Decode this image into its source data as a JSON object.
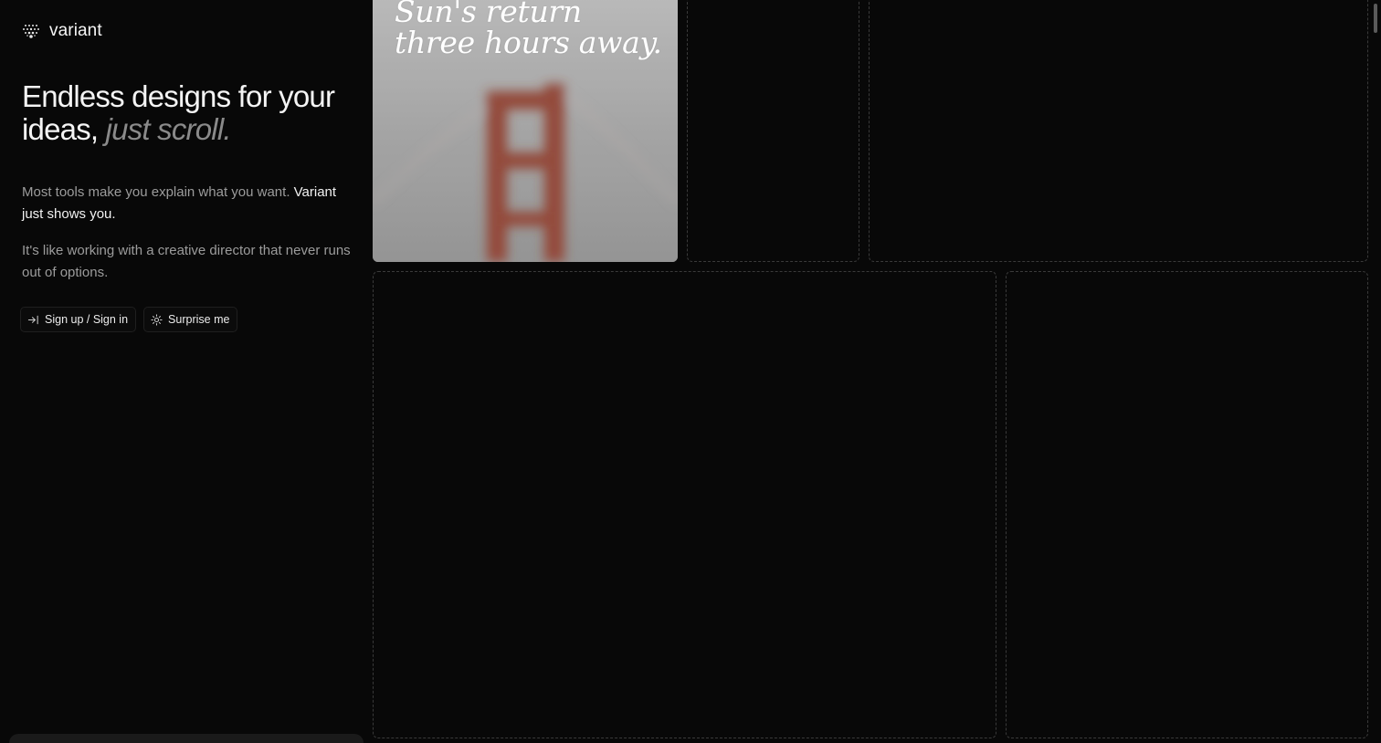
{
  "brand": {
    "name": "variant",
    "logo_icon": "dot-grid-logo-icon"
  },
  "hero": {
    "headline_main": "Endless designs for your ideas, ",
    "headline_accent": "just scroll.",
    "p1_main": "Most tools make you explain what you want. ",
    "p1_highlight": "Variant just shows you.",
    "p2": "It's like working with a creative director that never runs out of options."
  },
  "actions": {
    "signin_label": "Sign up / Sign in",
    "signin_icon": "arrow-right-to-line-icon",
    "surprise_label": "Surprise me",
    "surprise_icon": "sparkle-icon"
  },
  "grid": {
    "cards": [
      {
        "caption": "Sun's return three hours away.",
        "image": "foggy-golden-gate-bridge"
      }
    ]
  },
  "colors": {
    "background": "#080808",
    "text_primary": "#f2f2f2",
    "text_muted": "#9c9c9c",
    "accent_muted": "#8a8a8a",
    "card_border": "#3a3a3a",
    "bridge_red": "#8a3a2c"
  }
}
